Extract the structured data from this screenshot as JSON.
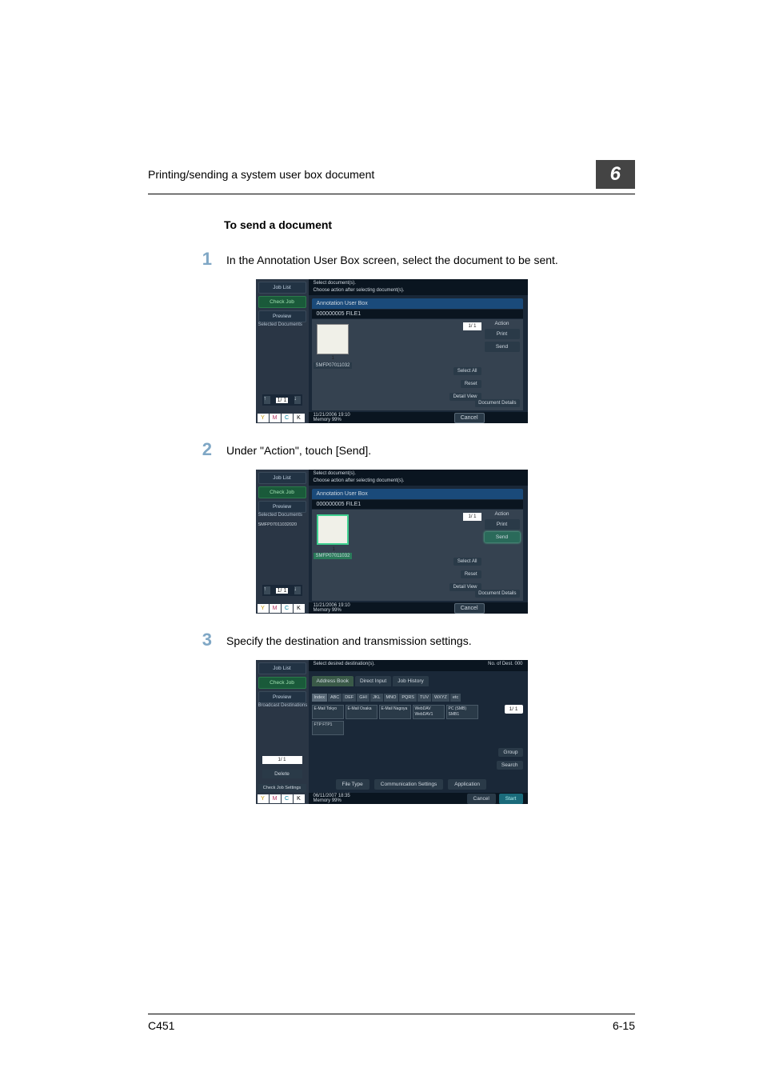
{
  "header": {
    "section_title": "Printing/sending a system user box document",
    "chapter_number": "6"
  },
  "heading": "To send a document",
  "steps": [
    {
      "num": "1",
      "text": "In the Annotation User Box screen, select the document to be sent."
    },
    {
      "num": "2",
      "text": "Under \"Action\", touch [Send]."
    },
    {
      "num": "3",
      "text": "Specify the destination and transmission settings."
    }
  ],
  "screenshot_common": {
    "job_list": "Job List",
    "check_job": "Check Job",
    "preview": "Preview",
    "selected_docs": "Selected Documents",
    "topline1": "Select document(s).",
    "topline2": "Choose action after selecting document(s).",
    "box_title": "Annotation User Box",
    "box_id": "000000005  FILE1",
    "thumb_name": "SMFP07011032",
    "pager": "1/  1",
    "action_label": "Action",
    "print": "Print",
    "send": "Send",
    "select_all": "Select All",
    "reset": "Reset",
    "detail_view": "Detail View",
    "document_details": "Document Details",
    "datetime": "11/21/2006   19:10",
    "memory": "Memory      99%",
    "cancel": "Cancel",
    "toner": {
      "y": "Y",
      "m": "M",
      "c": "C",
      "k": "K"
    },
    "left_pager": "1/  1"
  },
  "screenshot2_selected": "SMFP07011032020",
  "screenshot3": {
    "topline": "Select desired destination(s).",
    "no_of_dest": "No. of Dest.   000",
    "broadcast": "Broadcast Destinations",
    "tab_address_book": "Address Book",
    "tab_direct_input": "Direct Input",
    "tab_job_history": "Job History",
    "alpha": [
      "Index",
      "ABC",
      "DEF",
      "GHI",
      "JKL",
      "MNO",
      "PQRS",
      "TUV",
      "WXYZ",
      "etc"
    ],
    "dest1": "E-Mail Tokyo",
    "dest2": "E-Mail Osaka",
    "dest3": "E-Mail Nagoya",
    "dest4": "WebDAV WebDAV1",
    "dest5": "PC (SMB) SMB1",
    "dest6": "FTP FTP1",
    "delete": "Delete",
    "check_job_set": "Check Job Settings",
    "file_type": "File Type",
    "comm_settings": "Communication Settings",
    "application": "Application",
    "group": "Group",
    "search": "Search",
    "pager": "1/  1",
    "datetime": "06/11/2007   18:35",
    "memory": "Memory      99%",
    "cancel": "Cancel",
    "start": "Start"
  },
  "footer": {
    "left": "C451",
    "right": "6-15"
  }
}
